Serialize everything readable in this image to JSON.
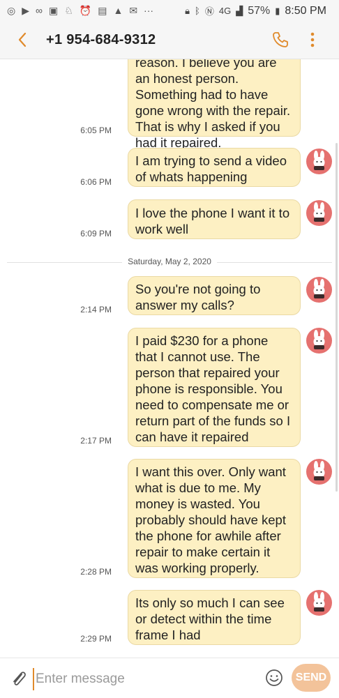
{
  "status_bar": {
    "time": "8:50 PM",
    "battery": "57%",
    "network": "4G",
    "left_icons": [
      "whatsapp-icon",
      "youtube-icon",
      "voicemail-icon",
      "chat-icon",
      "alarm-icon",
      "alarm-clock-icon",
      "message-icon",
      "warning-icon",
      "mail-icon",
      "more-dots-icon"
    ],
    "right_icons": [
      "lock-icon",
      "bluetooth-icon",
      "nfc-icon",
      "4g-icon",
      "signal-icon",
      "battery-icon"
    ]
  },
  "header": {
    "contact": "+1 954-684-9312"
  },
  "thread": {
    "date_separator": "Saturday, May 2, 2020",
    "messages": [
      {
        "text": "reason. I believe you are an honest person. Something had to have gone wrong with the repair. That is why I asked if you had it repaired.",
        "time": "6:05 PM"
      },
      {
        "text": "I am trying to send a video of whats happening",
        "time": "6:06 PM"
      },
      {
        "text": "I love the phone I want it to work well",
        "time": "6:09 PM"
      },
      {
        "text": "So you're not going to answer my calls?",
        "time": "2:14 PM"
      },
      {
        "text": "I paid $230 for a phone that I cannot use. The person that repaired your phone is responsible. You need to compensate me or return part of the funds so I can have it repaired",
        "time": "2:17 PM"
      },
      {
        "text": "I want this over. Only want what is due to me. My money is wasted. You probably should have kept the phone for awhile after repair to make certain it was working properly.",
        "time": "2:28 PM"
      },
      {
        "text": "Its only so much I can see or detect within the time frame I had",
        "time": "2:29 PM"
      }
    ]
  },
  "composer": {
    "placeholder": "Enter message",
    "value": "",
    "send_label": "SEND"
  },
  "colors": {
    "bubble": "#fdf0c3",
    "accent": "#e08a2b",
    "avatar_bg": "#e5716f",
    "send_bg": "#f3c39a"
  }
}
